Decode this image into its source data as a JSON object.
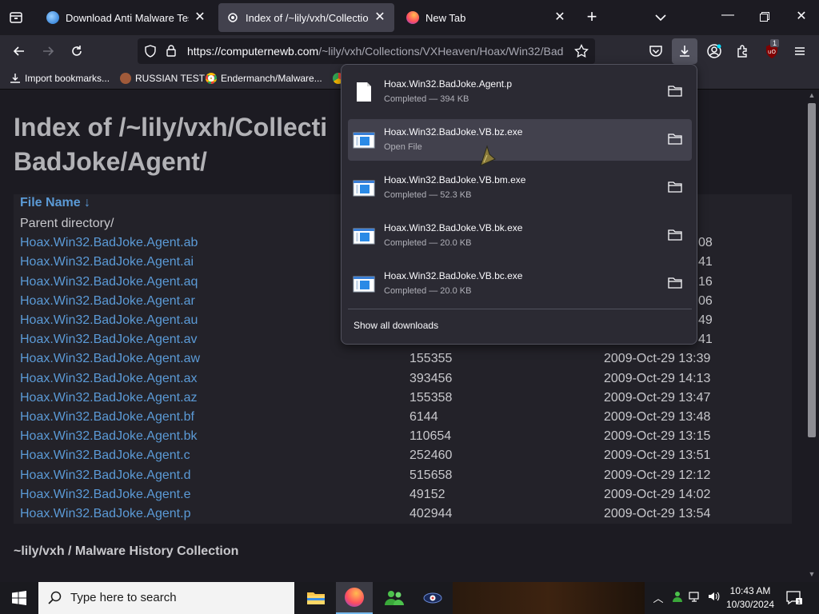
{
  "tabs": [
    {
      "title": "Download Anti Malware Testfile",
      "active": false
    },
    {
      "title": "Index of /~lily/vxh/Collections/",
      "active": true
    },
    {
      "title": "New Tab",
      "active": false
    }
  ],
  "urlbar": {
    "url_host": "https://computernewb.com",
    "url_path": "/~lily/vxh/Collections/VXHeaven/Hoax/Win32/Bad"
  },
  "bookmarks": [
    {
      "label": "Import bookmarks..."
    },
    {
      "label": "RUSSIAN TEST"
    },
    {
      "label": "Endermanch/Malware..."
    }
  ],
  "extension_badge": "1",
  "page": {
    "title": "Index of /~lily/vxh/Collecti\nBadJoke/Agent/",
    "title_line1": "Index of /~lily/vxh/Collecti",
    "title_line2": "BadJoke/Agent/",
    "header": {
      "name": "File Name  ↓"
    },
    "rows": [
      {
        "name": "Parent directory/",
        "size": "",
        "date": ""
      },
      {
        "name": "Hoax.Win32.BadJoke.Agent.ab",
        "size": "",
        "date": "08"
      },
      {
        "name": "Hoax.Win32.BadJoke.Agent.ai",
        "size": "",
        "date": "41"
      },
      {
        "name": "Hoax.Win32.BadJoke.Agent.aq",
        "size": "",
        "date": "16"
      },
      {
        "name": "Hoax.Win32.BadJoke.Agent.ar",
        "size": "",
        "date": "06"
      },
      {
        "name": "Hoax.Win32.BadJoke.Agent.au",
        "size": "",
        "date": "49"
      },
      {
        "name": "Hoax.Win32.BadJoke.Agent.av",
        "size": "",
        "date": "41"
      },
      {
        "name": "Hoax.Win32.BadJoke.Agent.aw",
        "size": "155355",
        "date": "2009-Oct-29 13:39"
      },
      {
        "name": "Hoax.Win32.BadJoke.Agent.ax",
        "size": "393456",
        "date": "2009-Oct-29 14:13"
      },
      {
        "name": "Hoax.Win32.BadJoke.Agent.az",
        "size": "155358",
        "date": "2009-Oct-29 13:47"
      },
      {
        "name": "Hoax.Win32.BadJoke.Agent.bf",
        "size": "6144",
        "date": "2009-Oct-29 13:48"
      },
      {
        "name": "Hoax.Win32.BadJoke.Agent.bk",
        "size": "110654",
        "date": "2009-Oct-29 13:15"
      },
      {
        "name": "Hoax.Win32.BadJoke.Agent.c",
        "size": "252460",
        "date": "2009-Oct-29 13:51"
      },
      {
        "name": "Hoax.Win32.BadJoke.Agent.d",
        "size": "515658",
        "date": "2009-Oct-29 12:12"
      },
      {
        "name": "Hoax.Win32.BadJoke.Agent.e",
        "size": "49152",
        "date": "2009-Oct-29 14:02"
      },
      {
        "name": "Hoax.Win32.BadJoke.Agent.p",
        "size": "402944",
        "date": "2009-Oct-29 13:54"
      }
    ],
    "footer": "~lily/vxh / Malware History Collection"
  },
  "downloads": {
    "items": [
      {
        "name": "Hoax.Win32.BadJoke.Agent.p",
        "status": "Completed — 394 KB",
        "icon": "blank-file-icon"
      },
      {
        "name": "Hoax.Win32.BadJoke.VB.bz.exe",
        "status": "Open File",
        "icon": "exe-file-icon"
      },
      {
        "name": "Hoax.Win32.BadJoke.VB.bm.exe",
        "status": "Completed — 52.3 KB",
        "icon": "exe-file-icon"
      },
      {
        "name": "Hoax.Win32.BadJoke.VB.bk.exe",
        "status": "Completed — 20.0 KB",
        "icon": "exe-file-icon"
      },
      {
        "name": "Hoax.Win32.BadJoke.VB.bc.exe",
        "status": "Completed — 20.0 KB",
        "icon": "exe-file-icon"
      }
    ],
    "show_all": "Show all downloads"
  },
  "taskbar": {
    "search_placeholder": "Type here to search",
    "time": "10:43 AM",
    "date": "10/30/2024"
  },
  "colors": {
    "accent_link": "#5b9ad6",
    "page_bg": "#1c1b22",
    "toolbar_bg": "#2b2a33",
    "active_tab": "#42414d"
  }
}
